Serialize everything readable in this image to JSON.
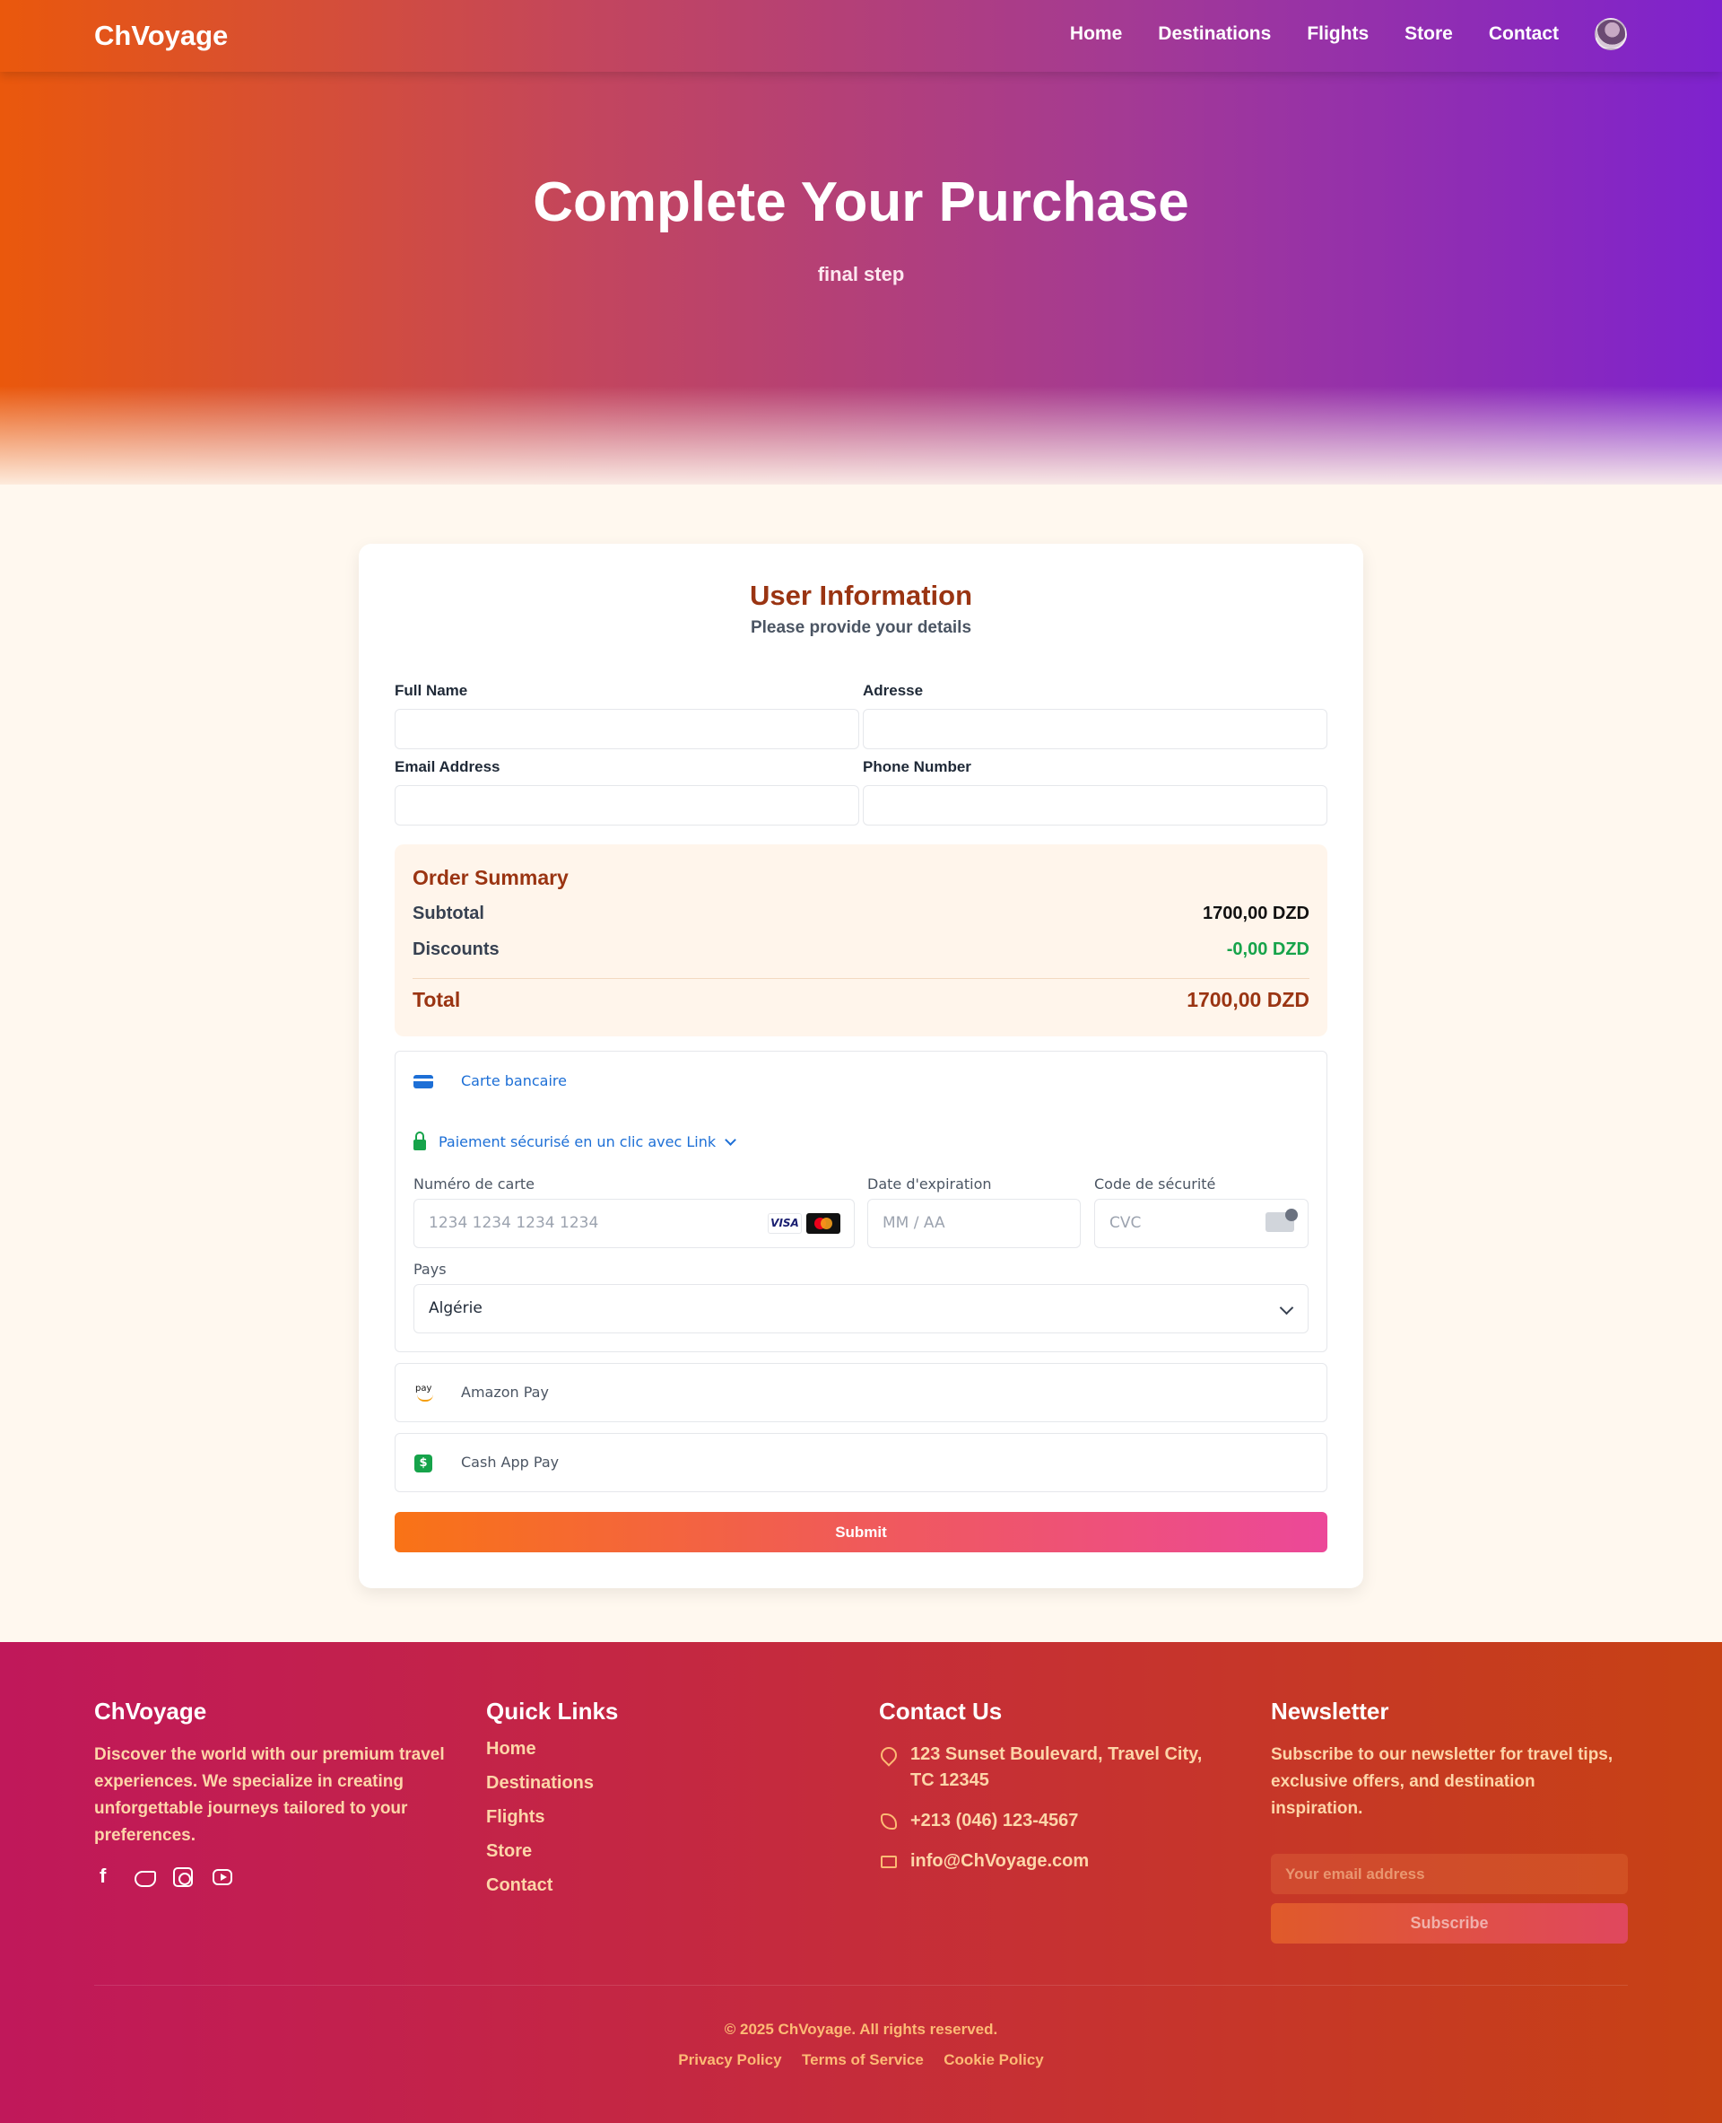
{
  "nav": {
    "brand": "ChVoyage",
    "links": [
      "Home",
      "Destinations",
      "Flights",
      "Store",
      "Contact"
    ]
  },
  "hero": {
    "title": "Complete Your Purchase",
    "subtitle": "final step"
  },
  "form": {
    "title": "User Information",
    "subtitle": "Please provide your details",
    "full_name_label": "Full Name",
    "address_label": "Adresse",
    "email_label": "Email Address",
    "phone_label": "Phone Number"
  },
  "summary": {
    "title": "Order Summary",
    "subtotal_label": "Subtotal",
    "subtotal_value": "1700,00 DZD",
    "discounts_label": "Discounts",
    "discounts_value": "-0,00 DZD",
    "total_label": "Total",
    "total_value": "1700,00 DZD"
  },
  "payment": {
    "card_method": "Carte bancaire",
    "link_text": "Paiement sécurisé en un clic avec Link",
    "card_number_label": "Numéro de carte",
    "card_number_placeholder": "1234 1234 1234 1234",
    "expiry_label": "Date d'expiration",
    "expiry_placeholder": "MM / AA",
    "cvc_label": "Code de sécurité",
    "cvc_placeholder": "CVC",
    "country_label": "Pays",
    "country_value": "Algérie",
    "amazon_pay": "Amazon Pay",
    "amazon_icon_text": "pay",
    "cash_app_pay": "Cash App Pay",
    "visa_text": "VISA",
    "submit_label": "Submit"
  },
  "footer": {
    "brand": "ChVoyage",
    "about": "Discover the world with our premium travel experiences. We specialize in creating unforgettable journeys tailored to your preferences.",
    "quick_links_title": "Quick Links",
    "quick_links": [
      "Home",
      "Destinations",
      "Flights",
      "Store",
      "Contact"
    ],
    "contact_title": "Contact Us",
    "address": "123 Sunset Boulevard, Travel City, TC 12345",
    "phone": "+213 (046) 123-4567",
    "email": "info@ChVoyage.com",
    "newsletter_title": "Newsletter",
    "newsletter_text": "Subscribe to our newsletter for travel tips, exclusive offers, and destination inspiration.",
    "newsletter_placeholder": "Your email address",
    "subscribe_label": "Subscribe",
    "copyright": "© 2025 ChVoyage. All rights reserved.",
    "legal_links": [
      "Privacy Policy",
      "Terms of Service",
      "Cookie Policy"
    ]
  },
  "colors": {
    "hero_start": "#ea580c",
    "hero_end": "#7e22ce",
    "accent": "#9a3412",
    "discount": "#16a34a",
    "link": "#1d6fd6"
  }
}
